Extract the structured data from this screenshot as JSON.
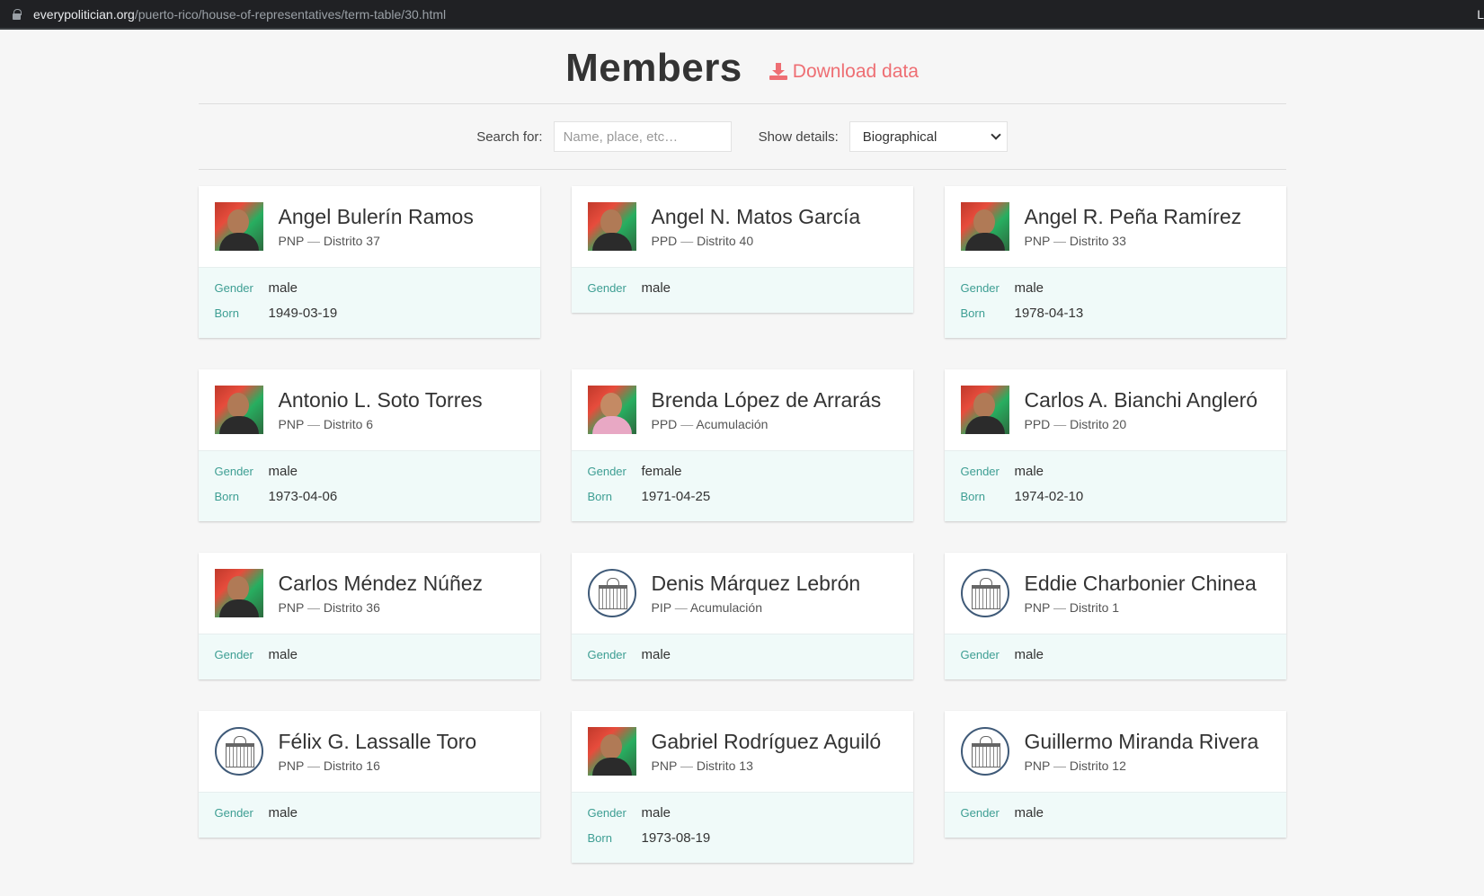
{
  "browser": {
    "domain": "everypolitician.org",
    "path": "/puerto-rico/house-of-representatives/term-table/30.html",
    "edge_char": "L"
  },
  "header": {
    "title": "Members",
    "download_label": "Download data"
  },
  "filters": {
    "search_label": "Search for:",
    "search_placeholder": "Name, place, etc…",
    "details_label": "Show details:",
    "details_value": "Biographical"
  },
  "members": [
    {
      "name": "Angel Bulerín Ramos",
      "party": "PNP",
      "area": "Distrito 37",
      "avatar": "photo",
      "gender_label": "Gender",
      "gender": "male",
      "born_label": "Born",
      "born": "1949-03-19"
    },
    {
      "name": "Angel N. Matos García",
      "party": "PPD",
      "area": "Distrito 40",
      "avatar": "photo",
      "gender_label": "Gender",
      "gender": "male"
    },
    {
      "name": "Angel R. Peña Ramírez",
      "party": "PNP",
      "area": "Distrito 33",
      "avatar": "photo",
      "gender_label": "Gender",
      "gender": "male",
      "born_label": "Born",
      "born": "1978-04-13"
    },
    {
      "name": "Antonio L. Soto Torres",
      "party": "PNP",
      "area": "Distrito 6",
      "avatar": "photo",
      "gender_label": "Gender",
      "gender": "male",
      "born_label": "Born",
      "born": "1973-04-06"
    },
    {
      "name": "Brenda López de Arrarás",
      "party": "PPD",
      "area": "Acumulación",
      "avatar": "photo-f",
      "gender_label": "Gender",
      "gender": "female",
      "born_label": "Born",
      "born": "1971-04-25"
    },
    {
      "name": "Carlos A. Bianchi Angleró",
      "party": "PPD",
      "area": "Distrito 20",
      "avatar": "photo",
      "gender_label": "Gender",
      "gender": "male",
      "born_label": "Born",
      "born": "1974-02-10"
    },
    {
      "name": "Carlos Méndez Núñez",
      "party": "PNP",
      "area": "Distrito 36",
      "avatar": "photo",
      "gender_label": "Gender",
      "gender": "male"
    },
    {
      "name": "Denis Márquez Lebrón",
      "party": "PIP",
      "area": "Acumulación",
      "avatar": "seal",
      "gender_label": "Gender",
      "gender": "male"
    },
    {
      "name": "Eddie Charbonier Chinea",
      "party": "PNP",
      "area": "Distrito 1",
      "avatar": "seal",
      "gender_label": "Gender",
      "gender": "male"
    },
    {
      "name": "Félix G. Lassalle Toro",
      "party": "PNP",
      "area": "Distrito 16",
      "avatar": "seal",
      "gender_label": "Gender",
      "gender": "male"
    },
    {
      "name": "Gabriel Rodríguez Aguiló",
      "party": "PNP",
      "area": "Distrito 13",
      "avatar": "photo",
      "gender_label": "Gender",
      "gender": "male",
      "born_label": "Born",
      "born": "1973-08-19"
    },
    {
      "name": "Guillermo Miranda Rivera",
      "party": "PNP",
      "area": "Distrito 12",
      "avatar": "seal",
      "gender_label": "Gender",
      "gender": "male"
    }
  ],
  "separator": "—"
}
